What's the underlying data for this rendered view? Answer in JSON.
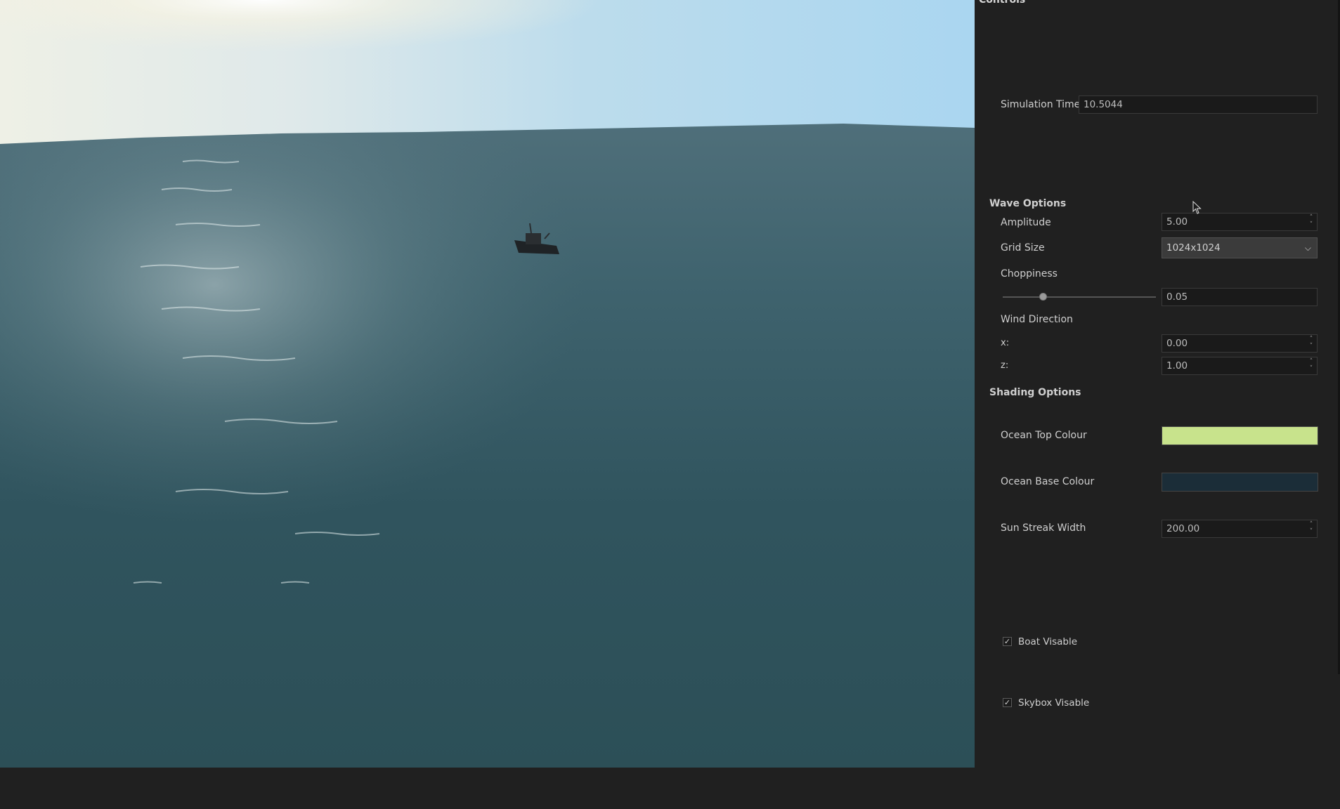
{
  "panel": {
    "title": "Controls",
    "simulation_time": {
      "label": "Simulation Time",
      "value": "10.5044"
    },
    "wave_options": {
      "heading": "Wave Options",
      "amplitude": {
        "label": "Amplitude",
        "value": "5.00"
      },
      "grid_size": {
        "label": "Grid Size",
        "value": "1024x1024"
      },
      "choppiness": {
        "label": "Choppiness",
        "value": "0.05",
        "slider_fraction": 0.26
      },
      "wind_direction": {
        "label": "Wind Direction",
        "x_label": "x:",
        "x_value": "0.00",
        "z_label": "z:",
        "z_value": "1.00"
      }
    },
    "shading_options": {
      "heading": "Shading Options",
      "ocean_top_colour": {
        "label": "Ocean Top Colour",
        "color": "#c8e38c"
      },
      "ocean_base_colour": {
        "label": "Ocean Base Colour",
        "color": "#1b2d38"
      },
      "sun_streak_width": {
        "label": "Sun Streak Width",
        "value": "200.00"
      }
    },
    "boat_visible": {
      "label": "Boat Visable",
      "checked": true,
      "check": "✓"
    },
    "skybox_visible": {
      "label": "Skybox Visable",
      "checked": true,
      "check": "✓"
    }
  },
  "icons": {
    "spin_up": "˄",
    "spin_down": "˅",
    "chevron": "⌵"
  },
  "colors": {
    "background": "#202020",
    "field_bg": "#1a1a1a"
  }
}
